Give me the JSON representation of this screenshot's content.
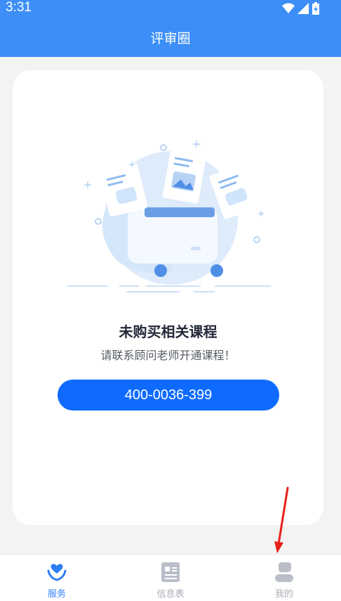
{
  "status_bar": {
    "time": "3:31"
  },
  "header": {
    "title": "评审圈"
  },
  "empty_state": {
    "title": "未购买相关课程",
    "subtitle": "请联系顾问老师开通课程！",
    "phone_button": "400-0036-399"
  },
  "bottom_nav": {
    "items": [
      {
        "label": "服务",
        "icon": "heart-hands-icon",
        "active": true
      },
      {
        "label": "信息表",
        "icon": "document-list-icon",
        "active": false
      },
      {
        "label": "我的",
        "icon": "person-icon",
        "active": false
      }
    ]
  },
  "colors": {
    "header": "#3d8ff7",
    "accent": "#0f6bff",
    "nav_active": "#2f7ff5",
    "nav_inactive": "#a8adb8",
    "annotation_arrow": "#e8201a"
  }
}
